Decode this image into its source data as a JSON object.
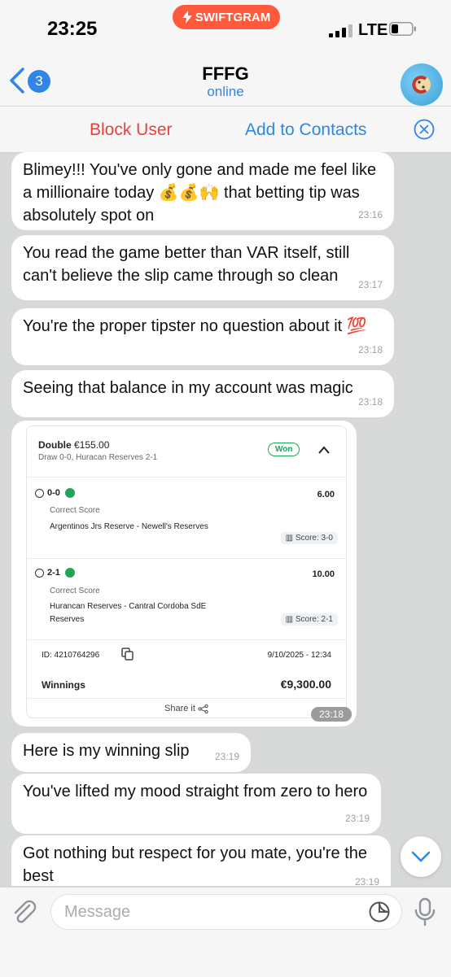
{
  "status_bar": {
    "time": "23:25",
    "app_badge": "SWIFTGRAM",
    "network": "LTE"
  },
  "header": {
    "unread_count": "3",
    "title": "FFFG",
    "status": "online"
  },
  "action_bar": {
    "block_label": "Block User",
    "add_label": "Add to Contacts"
  },
  "messages": [
    {
      "text": "Blimey!!! You've only gone and made me feel like a millionaire today 💰💰🙌 that betting tip was absolutely spot on",
      "time": "23:16"
    },
    {
      "text": "You read the game better than VAR itself, still can't believe the slip came through so clean",
      "time": "23:17"
    },
    {
      "text": "You're the proper tipster no question about it 💯",
      "time": "23:18"
    },
    {
      "text": "Seeing that balance in my account was magic",
      "time": "23:18"
    },
    {
      "text": "Here is my winning slip",
      "time": "23:19"
    },
    {
      "text": "You've lifted my mood straight from zero to hero",
      "time": "23:19"
    },
    {
      "text": "Got nothing but respect for you mate, you're the best",
      "time": "23:19"
    }
  ],
  "bet_slip": {
    "type": "Double",
    "stake": "€155.00",
    "summary": "Draw 0-0, Huracan Reserves 2-1",
    "status": "Won",
    "selections": [
      {
        "pick": "0-0",
        "market": "Correct Score",
        "odds": "6.00",
        "match": "Argentinos Jrs Reserve - Newell's Reserves",
        "result": "Score: 3-0"
      },
      {
        "pick": "2-1",
        "market": "Correct Score",
        "odds": "10.00",
        "match": "Hurancan Reserves - Cantral Cordoba SdE Reserves",
        "result": "Score: 2-1"
      }
    ],
    "id_label": "ID: 4210764296",
    "date": "9/10/2025 - 12:34",
    "winnings_label": "Winnings",
    "winnings_value": "€9,300.00",
    "share_label": "Share it",
    "time": "23:18"
  },
  "input": {
    "placeholder": "Message"
  }
}
